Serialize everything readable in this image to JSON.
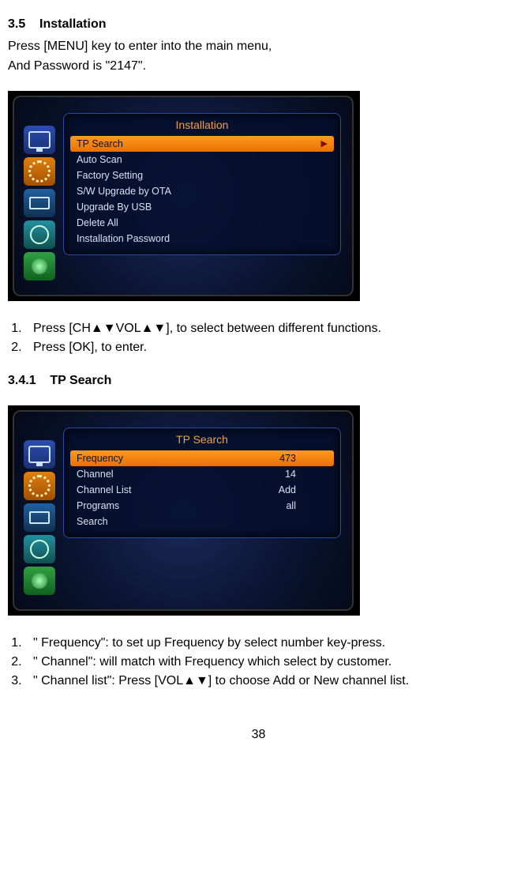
{
  "section": {
    "num": "3.5",
    "title": "Installation"
  },
  "intro": {
    "line1": "Press [MENU] key to enter into the main menu,",
    "line2": "And Password is \"2147\"."
  },
  "fig1": {
    "title": "Installation",
    "items": [
      {
        "label": "TP Search",
        "sel": true
      },
      {
        "label": "Auto Scan"
      },
      {
        "label": "Factory Setting"
      },
      {
        "label": "S/W Upgrade by OTA"
      },
      {
        "label": "Upgrade By USB"
      },
      {
        "label": "Delete All"
      },
      {
        "label": "Installation Password"
      }
    ]
  },
  "steps1": [
    "Press [CH▲▼VOL▲▼], to select between different functions.",
    "Press [OK], to enter."
  ],
  "subsection": {
    "num": "3.4.1",
    "title": "TP  Search"
  },
  "fig2": {
    "title": "TP Search",
    "items": [
      {
        "label": "Frequency",
        "value": "473",
        "sel": true
      },
      {
        "label": "Channel",
        "value": "14"
      },
      {
        "label": "Channel List",
        "value": "Add"
      },
      {
        "label": "Programs",
        "value": "all"
      },
      {
        "label": "Search",
        "value": ""
      }
    ]
  },
  "steps2": [
    "\" Frequency\": to set up Frequency by select number key-press.",
    "\" Channel\": will match with Frequency which select by customer.",
    "\" Channel list\": Press [VOL▲▼] to choose Add or New channel list."
  ],
  "page": "38"
}
